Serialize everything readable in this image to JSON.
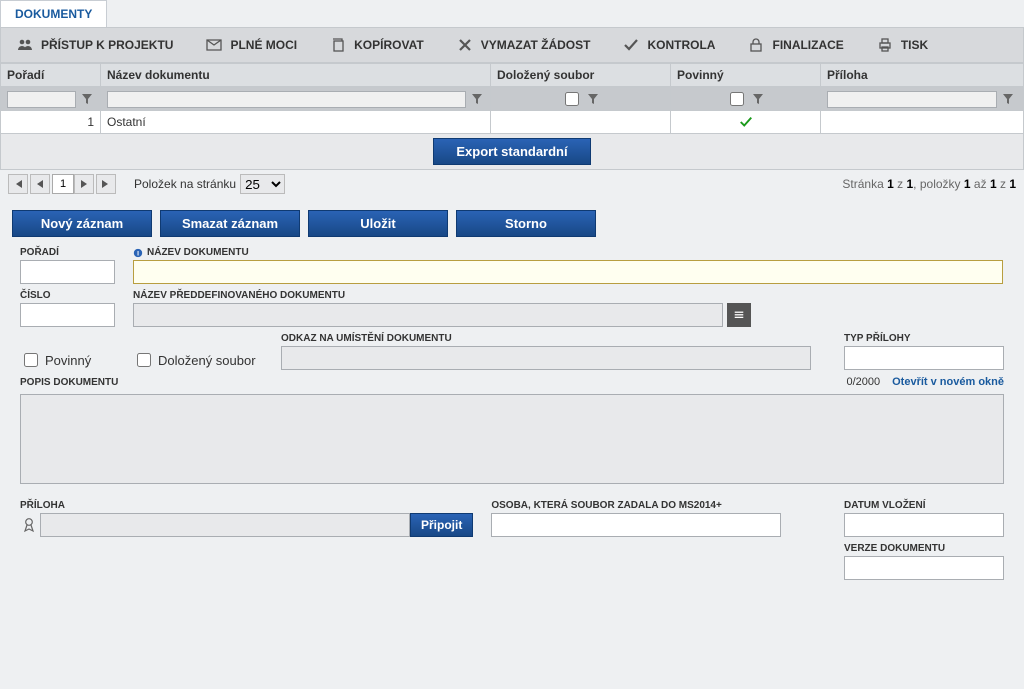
{
  "tab": {
    "title": "DOKUMENTY"
  },
  "toolbar": [
    {
      "id": "pristup",
      "label": "PŘÍSTUP K PROJEKTU",
      "icon": "people-icon"
    },
    {
      "id": "plnemoci",
      "label": "PLNÉ MOCI",
      "icon": "envelope-icon"
    },
    {
      "id": "kopirovat",
      "label": "KOPÍROVAT",
      "icon": "copy-icon"
    },
    {
      "id": "vymazat",
      "label": "VYMAZAT ŽÁDOST",
      "icon": "cross-icon"
    },
    {
      "id": "kontrola",
      "label": "KONTROLA",
      "icon": "check-icon"
    },
    {
      "id": "finalizace",
      "label": "FINALIZACE",
      "icon": "lock-icon"
    },
    {
      "id": "tisk",
      "label": "TISK",
      "icon": "print-icon"
    }
  ],
  "grid": {
    "columns": {
      "poradi": "Pořadí",
      "nazev": "Název dokumentu",
      "dolozeny": "Doložený soubor",
      "povinny": "Povinný",
      "priloha": "Příloha"
    },
    "rows": [
      {
        "poradi": "1",
        "nazev": "Ostatní",
        "dolozeny": "",
        "povinny_checked": true,
        "priloha": ""
      }
    ]
  },
  "export_btn": "Export standardní",
  "pager": {
    "page": "1",
    "items_per_page_label": "Položek na stránku",
    "items_per_page": "25",
    "info_prefix": "Stránka",
    "info_mid": "z",
    "info_items_prefix": "položky",
    "info_items_mid": "až",
    "pages_total": "1",
    "page_current": "1",
    "item_from": "1",
    "item_to": "1",
    "item_total": "1"
  },
  "actions": {
    "novy": "Nový záznam",
    "smazat": "Smazat záznam",
    "ulozit": "Uložit",
    "storno": "Storno"
  },
  "form": {
    "lbl_poradi": "POŘADÍ",
    "lbl_nazev": "NÁZEV DOKUMENTU",
    "lbl_cislo": "ČÍSLO",
    "lbl_predef": "NÁZEV PŘEDDEFINOVANÉHO DOKUMENTU",
    "lbl_povinny": "Povinný",
    "lbl_dolozeny": "Doložený soubor",
    "lbl_odkaz": "ODKAZ NA UMÍSTĚNÍ DOKUMENTU",
    "lbl_typ": "TYP PŘÍLOHY",
    "lbl_popis": "POPIS DOKUMENTU",
    "counter": "0/2000",
    "newwindow": "Otevřít v novém okně",
    "lbl_priloha": "PŘÍLOHA",
    "btn_pripojit": "Připojit",
    "lbl_osoba": "OSOBA, KTERÁ SOUBOR ZADALA DO MS2014+",
    "lbl_datum": "DATUM VLOŽENÍ",
    "lbl_verze": "VERZE DOKUMENTU"
  }
}
